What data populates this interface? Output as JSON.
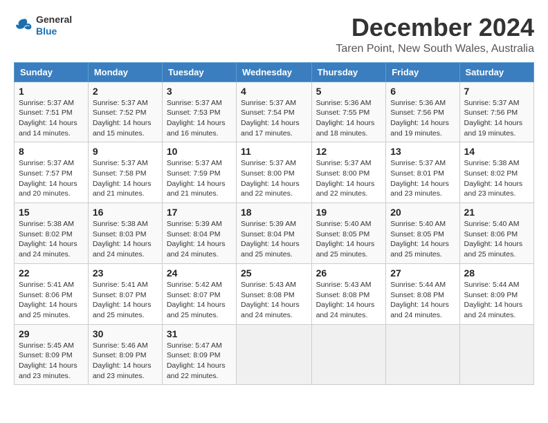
{
  "header": {
    "logo": {
      "general": "General",
      "blue": "Blue"
    },
    "title": "December 2024",
    "location": "Taren Point, New South Wales, Australia"
  },
  "weekdays": [
    "Sunday",
    "Monday",
    "Tuesday",
    "Wednesday",
    "Thursday",
    "Friday",
    "Saturday"
  ],
  "weeks": [
    [
      {
        "day": "1",
        "sunrise": "5:37 AM",
        "sunset": "7:51 PM",
        "daylight": "14 hours and 14 minutes."
      },
      {
        "day": "2",
        "sunrise": "5:37 AM",
        "sunset": "7:52 PM",
        "daylight": "14 hours and 15 minutes."
      },
      {
        "day": "3",
        "sunrise": "5:37 AM",
        "sunset": "7:53 PM",
        "daylight": "14 hours and 16 minutes."
      },
      {
        "day": "4",
        "sunrise": "5:37 AM",
        "sunset": "7:54 PM",
        "daylight": "14 hours and 17 minutes."
      },
      {
        "day": "5",
        "sunrise": "5:36 AM",
        "sunset": "7:55 PM",
        "daylight": "14 hours and 18 minutes."
      },
      {
        "day": "6",
        "sunrise": "5:36 AM",
        "sunset": "7:56 PM",
        "daylight": "14 hours and 19 minutes."
      },
      {
        "day": "7",
        "sunrise": "5:37 AM",
        "sunset": "7:56 PM",
        "daylight": "14 hours and 19 minutes."
      }
    ],
    [
      {
        "day": "8",
        "sunrise": "5:37 AM",
        "sunset": "7:57 PM",
        "daylight": "14 hours and 20 minutes."
      },
      {
        "day": "9",
        "sunrise": "5:37 AM",
        "sunset": "7:58 PM",
        "daylight": "14 hours and 21 minutes."
      },
      {
        "day": "10",
        "sunrise": "5:37 AM",
        "sunset": "7:59 PM",
        "daylight": "14 hours and 21 minutes."
      },
      {
        "day": "11",
        "sunrise": "5:37 AM",
        "sunset": "8:00 PM",
        "daylight": "14 hours and 22 minutes."
      },
      {
        "day": "12",
        "sunrise": "5:37 AM",
        "sunset": "8:00 PM",
        "daylight": "14 hours and 22 minutes."
      },
      {
        "day": "13",
        "sunrise": "5:37 AM",
        "sunset": "8:01 PM",
        "daylight": "14 hours and 23 minutes."
      },
      {
        "day": "14",
        "sunrise": "5:38 AM",
        "sunset": "8:02 PM",
        "daylight": "14 hours and 23 minutes."
      }
    ],
    [
      {
        "day": "15",
        "sunrise": "5:38 AM",
        "sunset": "8:02 PM",
        "daylight": "14 hours and 24 minutes."
      },
      {
        "day": "16",
        "sunrise": "5:38 AM",
        "sunset": "8:03 PM",
        "daylight": "14 hours and 24 minutes."
      },
      {
        "day": "17",
        "sunrise": "5:39 AM",
        "sunset": "8:04 PM",
        "daylight": "14 hours and 24 minutes."
      },
      {
        "day": "18",
        "sunrise": "5:39 AM",
        "sunset": "8:04 PM",
        "daylight": "14 hours and 25 minutes."
      },
      {
        "day": "19",
        "sunrise": "5:40 AM",
        "sunset": "8:05 PM",
        "daylight": "14 hours and 25 minutes."
      },
      {
        "day": "20",
        "sunrise": "5:40 AM",
        "sunset": "8:05 PM",
        "daylight": "14 hours and 25 minutes."
      },
      {
        "day": "21",
        "sunrise": "5:40 AM",
        "sunset": "8:06 PM",
        "daylight": "14 hours and 25 minutes."
      }
    ],
    [
      {
        "day": "22",
        "sunrise": "5:41 AM",
        "sunset": "8:06 PM",
        "daylight": "14 hours and 25 minutes."
      },
      {
        "day": "23",
        "sunrise": "5:41 AM",
        "sunset": "8:07 PM",
        "daylight": "14 hours and 25 minutes."
      },
      {
        "day": "24",
        "sunrise": "5:42 AM",
        "sunset": "8:07 PM",
        "daylight": "14 hours and 25 minutes."
      },
      {
        "day": "25",
        "sunrise": "5:43 AM",
        "sunset": "8:08 PM",
        "daylight": "14 hours and 24 minutes."
      },
      {
        "day": "26",
        "sunrise": "5:43 AM",
        "sunset": "8:08 PM",
        "daylight": "14 hours and 24 minutes."
      },
      {
        "day": "27",
        "sunrise": "5:44 AM",
        "sunset": "8:08 PM",
        "daylight": "14 hours and 24 minutes."
      },
      {
        "day": "28",
        "sunrise": "5:44 AM",
        "sunset": "8:09 PM",
        "daylight": "14 hours and 24 minutes."
      }
    ],
    [
      {
        "day": "29",
        "sunrise": "5:45 AM",
        "sunset": "8:09 PM",
        "daylight": "14 hours and 23 minutes."
      },
      {
        "day": "30",
        "sunrise": "5:46 AM",
        "sunset": "8:09 PM",
        "daylight": "14 hours and 23 minutes."
      },
      {
        "day": "31",
        "sunrise": "5:47 AM",
        "sunset": "8:09 PM",
        "daylight": "14 hours and 22 minutes."
      },
      null,
      null,
      null,
      null
    ]
  ]
}
